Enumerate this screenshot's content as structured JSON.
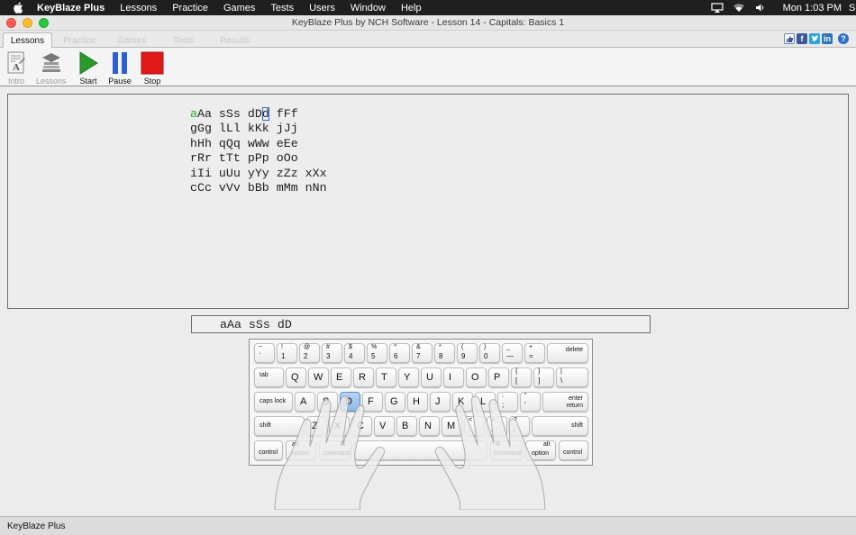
{
  "menubar": {
    "app_name": "KeyBlaze Plus",
    "items": [
      "Lessons",
      "Practice",
      "Games",
      "Tests",
      "Users",
      "Window",
      "Help"
    ],
    "clock": "Mon 1:03 PM",
    "extra": "S"
  },
  "window": {
    "title": "KeyBlaze Plus by NCH Software - Lesson 14 - Capitals: Basics 1"
  },
  "tabs": {
    "active": "Lessons",
    "inactive": [
      "Practice",
      "Games",
      "Tests",
      "Results"
    ]
  },
  "toolbar": {
    "intro": "Intro",
    "lessons": "Lessons",
    "start": "Start",
    "pause": "Pause",
    "stop": "Stop"
  },
  "lesson": {
    "typed_prefix": "a",
    "line1_mid": "Aa sSs dD",
    "cursor_char": "d",
    "line1_rest": " fFf",
    "lines": [
      "gGg lLl kKk jJj",
      "hHh qQq wWw eEe",
      "rRr tTt pPp oOo",
      "iIi uUu yYy zZz xXx",
      "cCc vVv bBb mMm nNn"
    ],
    "input_text": "aAa sSs dD"
  },
  "keyboard": {
    "highlighted_key": "D",
    "row1": [
      {
        "top": "~",
        "bot": "`"
      },
      {
        "top": "!",
        "bot": "1"
      },
      {
        "top": "@",
        "bot": "2"
      },
      {
        "top": "#",
        "bot": "3"
      },
      {
        "top": "$",
        "bot": "4"
      },
      {
        "top": "%",
        "bot": "5"
      },
      {
        "top": "^",
        "bot": "6"
      },
      {
        "top": "&",
        "bot": "7"
      },
      {
        "top": "*",
        "bot": "8"
      },
      {
        "top": "(",
        "bot": "9"
      },
      {
        "top": ")",
        "bot": "0"
      },
      {
        "top": "_",
        "bot": "—"
      },
      {
        "top": "+",
        "bot": "="
      }
    ],
    "delete": "delete",
    "tab": "tab",
    "row2": [
      "Q",
      "W",
      "E",
      "R",
      "T",
      "Y",
      "U",
      "I",
      "O",
      "P"
    ],
    "row2_sym": [
      {
        "top": "{",
        "bot": "["
      },
      {
        "top": "}",
        "bot": "]"
      },
      {
        "top": "|",
        "bot": "\\"
      }
    ],
    "caps": "caps lock",
    "row3": [
      "A",
      "S",
      "D",
      "F",
      "G",
      "H",
      "J",
      "K",
      "L"
    ],
    "row3_sym": [
      {
        "top": ":",
        "bot": ";"
      },
      {
        "top": "\"",
        "bot": "'"
      }
    ],
    "enter_top": "enter",
    "enter_bot": "return",
    "shift": "shift",
    "row4": [
      "Z",
      "X",
      "C",
      "V",
      "B",
      "N",
      "M"
    ],
    "row4_sym": [
      {
        "top": "<",
        "bot": ","
      },
      {
        "top": ">",
        "bot": "."
      },
      {
        "top": "?",
        "bot": "/"
      }
    ],
    "control": "control",
    "alt_top": "alt",
    "option": "option",
    "cmd_top": "⌘",
    "command": "command"
  },
  "statusbar": {
    "text": "KeyBlaze Plus"
  },
  "colors": {
    "typed": "#22aa22",
    "highlight_key": "#9fc3ec",
    "cursor": "#2c6fd6"
  }
}
